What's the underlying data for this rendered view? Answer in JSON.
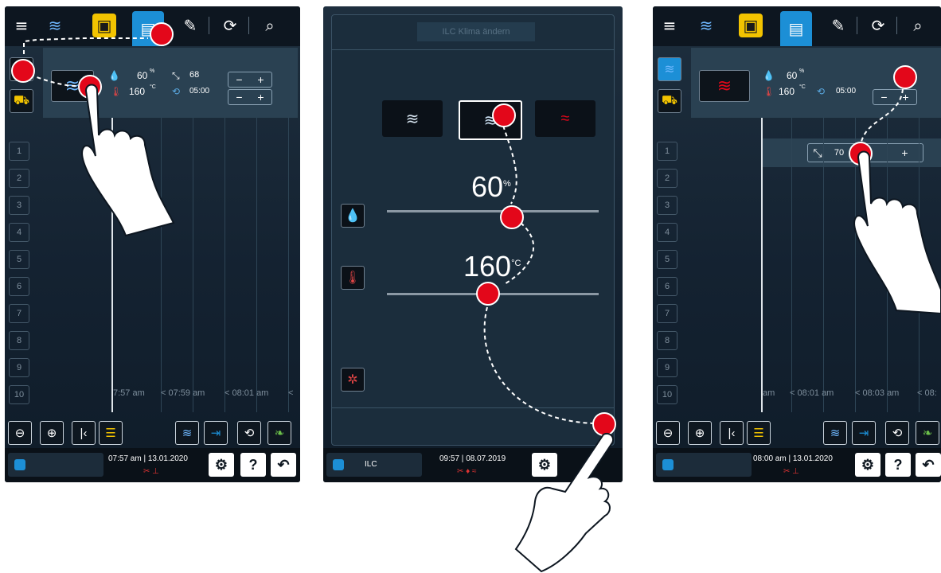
{
  "colors": {
    "accent": "#1c8fd6",
    "highlight": "#f2c300",
    "touch_marker": "#e3071a",
    "screen_bg": "#142231"
  },
  "icons": {
    "menu": "menu-icon",
    "steam": "steam-icon",
    "combi": "combi-icon",
    "dry": "dry-heat-icon",
    "booklet": "cook-book-icon",
    "planner": "ilc-planner-icon",
    "edit": "edit-icon",
    "cycle": "cycle-add-icon",
    "search": "search-icon",
    "basket": "basket-icon",
    "humidity": "humidity-icon",
    "temperature": "thermometer-icon",
    "fan": "fan-icon",
    "probe": "core-probe-icon",
    "timer": "timer-icon",
    "zoom_out": "zoom-out-icon",
    "zoom_in": "zoom-in-icon",
    "back": "back-icon",
    "settings": "settings-icon",
    "help": "help-icon",
    "return": "return-icon"
  },
  "screen1": {
    "humidity": "60",
    "humidity_unit": "%",
    "temperature": "160",
    "temperature_unit": "°C",
    "core_temp": "68",
    "core_temp_unit": "°",
    "timer": "05:00",
    "timer_unit": "'",
    "shelves": [
      "1",
      "2",
      "3",
      "4",
      "5",
      "6",
      "7",
      "8",
      "9",
      "10"
    ],
    "times": [
      "7:57 am",
      "< 07:59 am",
      "< 08:01 am",
      "<"
    ],
    "status_time": "07:57 am",
    "status_date": "13.01.2020"
  },
  "screen2": {
    "title": "ILC Klima ändern",
    "humidity": "60",
    "humidity_unit": "%",
    "temperature": "160",
    "temperature_unit": "°C",
    "status_label": "ILC",
    "status_time": "09:57",
    "status_date": "08.07.2019"
  },
  "screen3": {
    "humidity": "60",
    "humidity_unit": "%",
    "temperature": "160",
    "temperature_unit": "°C",
    "timer": "05:00",
    "timer_unit": "'",
    "core_temp": "70",
    "shelves": [
      "1",
      "2",
      "3",
      "4",
      "5",
      "6",
      "7",
      "8",
      "9",
      "10"
    ],
    "times": [
      "am",
      "< 08:01 am",
      "< 08:03 am",
      "< 08:"
    ],
    "status_time": "08:00 am",
    "status_date": "13.01.2020"
  },
  "symbols": {
    "minus": "−",
    "plus": "+",
    "help": "?"
  }
}
